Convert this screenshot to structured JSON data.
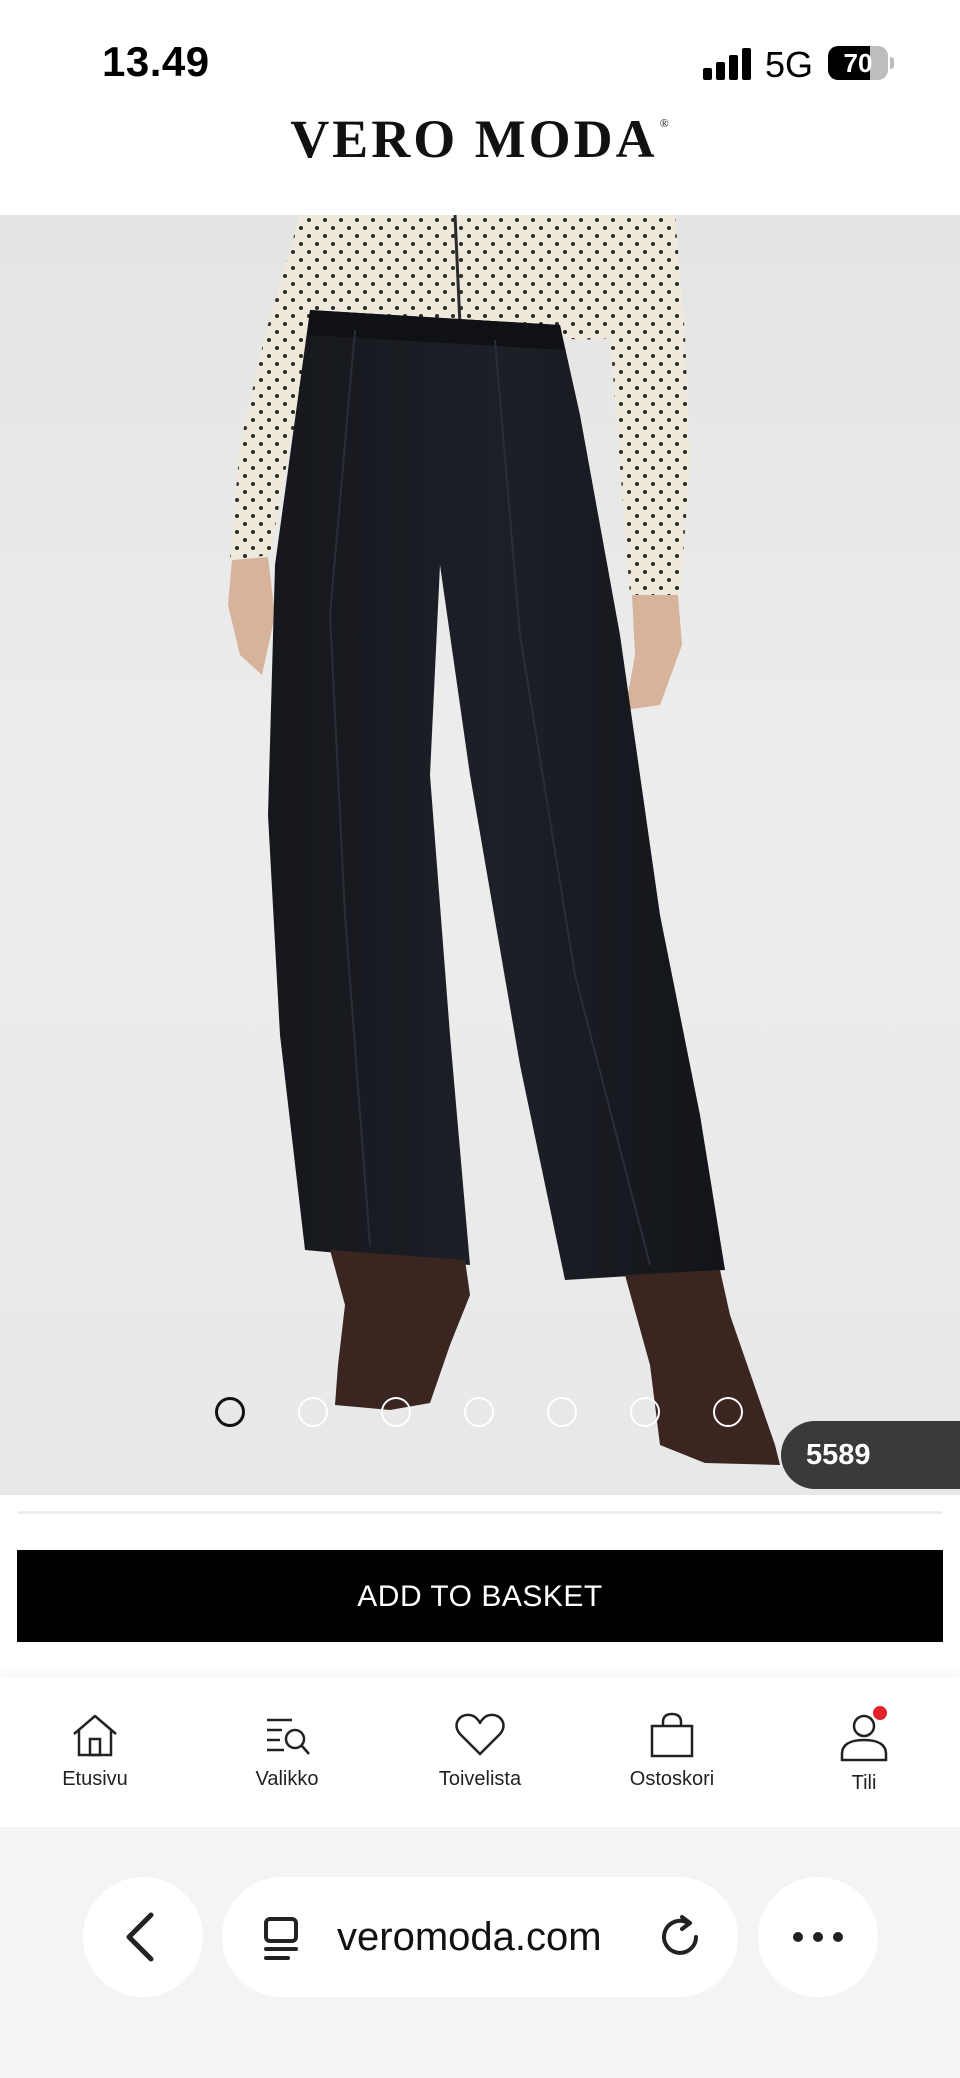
{
  "status_bar": {
    "time": "13.49",
    "network": "5G",
    "battery_percent": "70",
    "battery_level": 0.7
  },
  "brand": {
    "name": "VERO MODA",
    "mark": "®"
  },
  "product": {
    "image": "black wide-leg trousers with front seams, polka-dot blouse, dark brown pointed ankle boots",
    "sku_badge": "5589",
    "carousel": {
      "total": 7,
      "active_index": 0
    }
  },
  "actions": {
    "add_to_basket": "ADD TO BASKET"
  },
  "bottom_nav": {
    "items": [
      {
        "label": "Etusivu",
        "icon": "home-icon"
      },
      {
        "label": "Valikko",
        "icon": "menu-search-icon"
      },
      {
        "label": "Toivelista",
        "icon": "heart-icon"
      },
      {
        "label": "Ostoskori",
        "icon": "shopping-bag-icon"
      },
      {
        "label": "Tili",
        "icon": "user-icon",
        "notification": true
      }
    ]
  },
  "browser": {
    "url": "veromoda.com",
    "icons": [
      "back-icon",
      "page-menu-icon",
      "reload-icon",
      "more-icon"
    ]
  },
  "colors": {
    "button_bg": "#000000",
    "badge_bg": "#3a3a3a",
    "notification": "#e5232b"
  }
}
